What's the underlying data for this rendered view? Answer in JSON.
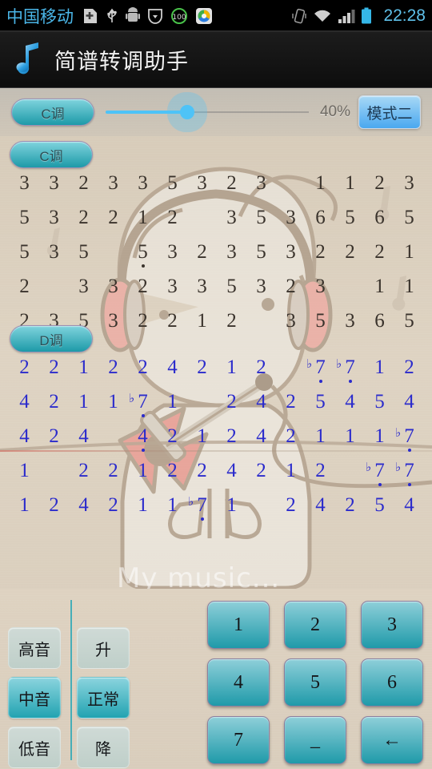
{
  "statusbar": {
    "carrier": "中国移动",
    "clock": "22:28",
    "icons": [
      "plus-badge-icon",
      "usb-icon",
      "android-robot-icon",
      "shield-download-icon",
      "score-100-icon",
      "browser-icon",
      "vibrate-icon",
      "wifi-icon",
      "signal-icon",
      "battery-icon"
    ]
  },
  "titlebar": {
    "icon": "music-note-icon",
    "title": "简谱转调助手"
  },
  "toolbar": {
    "key_button": "C调",
    "slider_value": 40,
    "percent_label": "40%",
    "mode_button": "模式二",
    "accent_color": "#4ec3f7",
    "key_button_color": "#1d9aa8",
    "mode_button_color": "#4aa8f0"
  },
  "watermark": "My music...",
  "sections": [
    {
      "key_label": "C调",
      "note_color": "#3a332c",
      "rows": [
        [
          {
            "n": "3"
          },
          {
            "n": "3"
          },
          {
            "n": "2"
          },
          {
            "n": "3"
          },
          {
            "n": "3"
          },
          {
            "n": "5"
          },
          {
            "n": "3"
          },
          {
            "n": "2"
          },
          {
            "n": "3"
          },
          {
            "n": ""
          },
          {
            "n": "1"
          },
          {
            "n": "1"
          },
          {
            "n": "2"
          },
          {
            "n": "3"
          }
        ],
        [
          {
            "n": "5"
          },
          {
            "n": "3"
          },
          {
            "n": "2"
          },
          {
            "n": "2"
          },
          {
            "n": "1"
          },
          {
            "n": "2"
          },
          {
            "n": ""
          },
          {
            "n": "3"
          },
          {
            "n": "5"
          },
          {
            "n": "3"
          },
          {
            "n": "6"
          },
          {
            "n": "5"
          },
          {
            "n": "6"
          },
          {
            "n": "5"
          }
        ],
        [
          {
            "n": "5"
          },
          {
            "n": "3"
          },
          {
            "n": "5"
          },
          {
            "n": ""
          },
          {
            "n": "5",
            "low": true
          },
          {
            "n": "3"
          },
          {
            "n": "2"
          },
          {
            "n": "3"
          },
          {
            "n": "5"
          },
          {
            "n": "3"
          },
          {
            "n": "2"
          },
          {
            "n": "2"
          },
          {
            "n": "2"
          },
          {
            "n": "1"
          }
        ],
        [
          {
            "n": "2"
          },
          {
            "n": ""
          },
          {
            "n": "3"
          },
          {
            "n": "3"
          },
          {
            "n": "2"
          },
          {
            "n": "3"
          },
          {
            "n": "3"
          },
          {
            "n": "5"
          },
          {
            "n": "3"
          },
          {
            "n": "2"
          },
          {
            "n": "3"
          },
          {
            "n": ""
          },
          {
            "n": "1"
          },
          {
            "n": "1"
          }
        ],
        [
          {
            "n": "2"
          },
          {
            "n": "3"
          },
          {
            "n": "5"
          },
          {
            "n": "3"
          },
          {
            "n": "2"
          },
          {
            "n": "2"
          },
          {
            "n": "1"
          },
          {
            "n": "2"
          },
          {
            "n": ""
          },
          {
            "n": "3"
          },
          {
            "n": "5"
          },
          {
            "n": "3"
          },
          {
            "n": "6"
          },
          {
            "n": "5"
          }
        ]
      ]
    },
    {
      "key_label": "D调",
      "note_color": "#2b2bcc",
      "rows": [
        [
          {
            "n": "2"
          },
          {
            "n": "2"
          },
          {
            "n": "1"
          },
          {
            "n": "2"
          },
          {
            "n": "2"
          },
          {
            "n": "4"
          },
          {
            "n": "2"
          },
          {
            "n": "1"
          },
          {
            "n": "2"
          },
          {
            "n": ""
          },
          {
            "n": "7",
            "flat": true,
            "low": true
          },
          {
            "n": "7",
            "flat": true,
            "low": true
          },
          {
            "n": "1"
          },
          {
            "n": "2"
          }
        ],
        [
          {
            "n": "4"
          },
          {
            "n": "2"
          },
          {
            "n": "1"
          },
          {
            "n": "1"
          },
          {
            "n": "7",
            "flat": true,
            "low": true
          },
          {
            "n": "1"
          },
          {
            "n": ""
          },
          {
            "n": "2"
          },
          {
            "n": "4"
          },
          {
            "n": "2"
          },
          {
            "n": "5"
          },
          {
            "n": "4"
          },
          {
            "n": "5"
          },
          {
            "n": "4"
          }
        ],
        [
          {
            "n": "4"
          },
          {
            "n": "2"
          },
          {
            "n": "4"
          },
          {
            "n": ""
          },
          {
            "n": "4",
            "low": true
          },
          {
            "n": "2"
          },
          {
            "n": "1"
          },
          {
            "n": "2"
          },
          {
            "n": "4"
          },
          {
            "n": "2"
          },
          {
            "n": "1"
          },
          {
            "n": "1"
          },
          {
            "n": "1"
          },
          {
            "n": "7",
            "flat": true,
            "low": true
          }
        ],
        [
          {
            "n": "1"
          },
          {
            "n": ""
          },
          {
            "n": "2"
          },
          {
            "n": "2"
          },
          {
            "n": "1"
          },
          {
            "n": "2"
          },
          {
            "n": "2"
          },
          {
            "n": "4"
          },
          {
            "n": "2"
          },
          {
            "n": "1"
          },
          {
            "n": "2"
          },
          {
            "n": ""
          },
          {
            "n": "7",
            "flat": true,
            "low": true
          },
          {
            "n": "7",
            "flat": true,
            "low": true
          }
        ],
        [
          {
            "n": "1"
          },
          {
            "n": "2"
          },
          {
            "n": "4"
          },
          {
            "n": "2"
          },
          {
            "n": "1"
          },
          {
            "n": "1"
          },
          {
            "n": "7",
            "flat": true,
            "low": true
          },
          {
            "n": "1"
          },
          {
            "n": ""
          },
          {
            "n": "2"
          },
          {
            "n": "4"
          },
          {
            "n": "2"
          },
          {
            "n": "5"
          },
          {
            "n": "4"
          }
        ]
      ]
    }
  ],
  "octave_buttons": [
    {
      "label": "高音",
      "selected": false
    },
    {
      "label": "中音",
      "selected": true
    },
    {
      "label": "低音",
      "selected": false
    }
  ],
  "accidental_buttons": [
    {
      "label": "升",
      "selected": false
    },
    {
      "label": "正常",
      "selected": true
    },
    {
      "label": "降",
      "selected": false
    }
  ],
  "keypad": [
    {
      "label": "1",
      "name": "key-1"
    },
    {
      "label": "2",
      "name": "key-2"
    },
    {
      "label": "3",
      "name": "key-3"
    },
    {
      "label": "4",
      "name": "key-4"
    },
    {
      "label": "5",
      "name": "key-5"
    },
    {
      "label": "6",
      "name": "key-6"
    },
    {
      "label": "7",
      "name": "key-7"
    },
    {
      "label": "_",
      "name": "key-underscore"
    },
    {
      "label": "←",
      "name": "key-backspace"
    }
  ]
}
